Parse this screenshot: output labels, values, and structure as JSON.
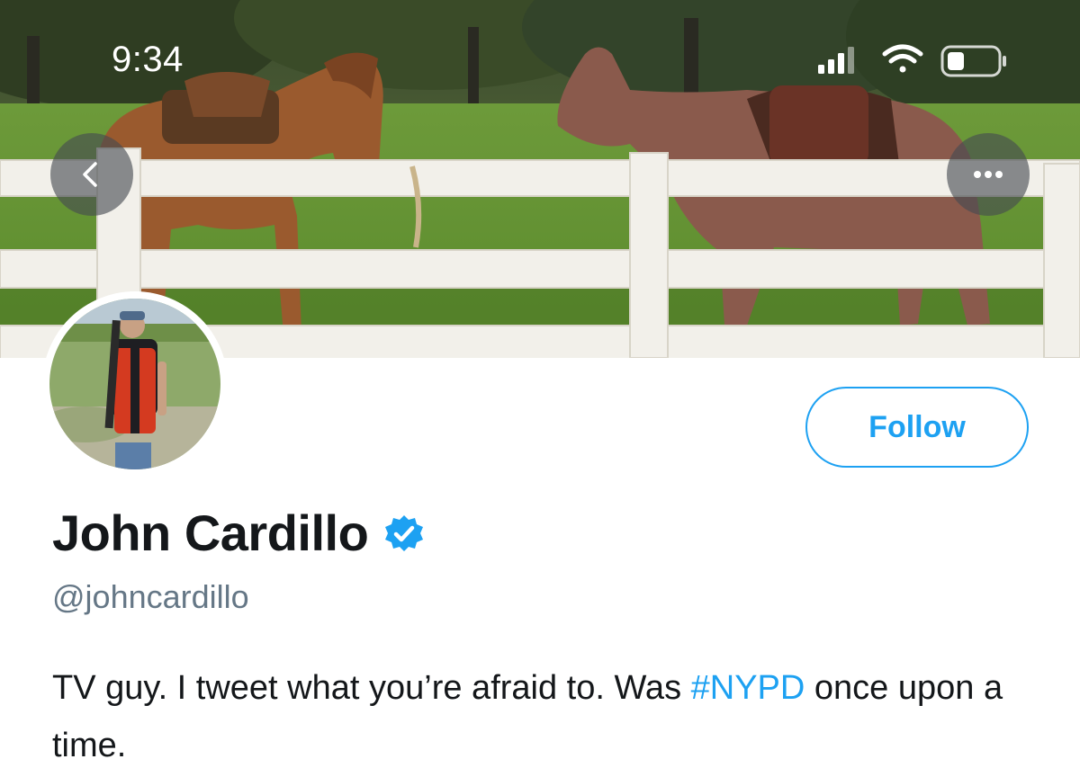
{
  "status_bar": {
    "time": "9:34",
    "icons": [
      "signal-icon",
      "wifi-icon",
      "battery-icon"
    ]
  },
  "header": {
    "banner_description_icon": "header-photo",
    "back_icon": "chevron-left-icon",
    "more_icon": "more-horizontal-icon"
  },
  "profile": {
    "display_name": "John Cardillo",
    "verified": true,
    "handle": "@johncardillo",
    "follow_label": "Follow",
    "bio_before": "TV guy. I tweet what you’re afraid to. Was ",
    "bio_hashtag": "#NYPD",
    "bio_after": " once upon a time."
  },
  "colors": {
    "accent": "#1da1f2",
    "text_primary": "#14171a",
    "text_secondary": "#657786"
  }
}
